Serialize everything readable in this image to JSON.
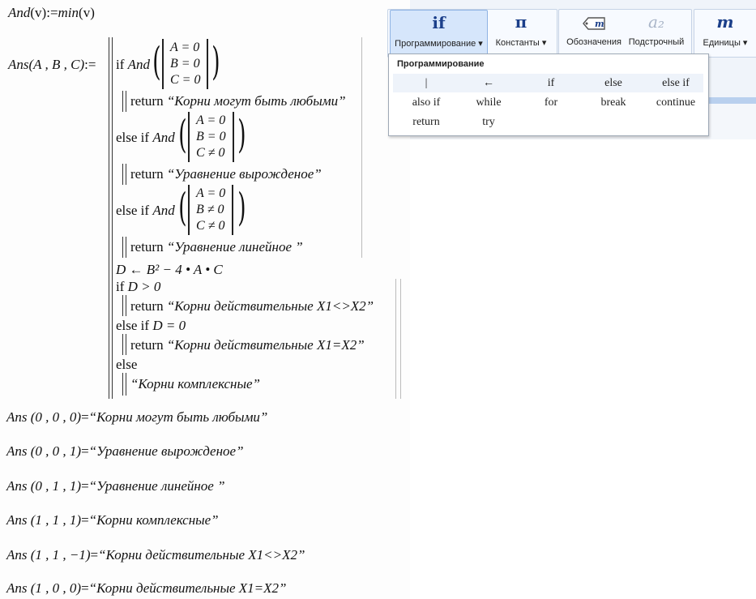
{
  "worksheet": {
    "def_and": {
      "lhs": "And",
      "arg": "(v)",
      "assign": ":=",
      "rhs": "min",
      "rhs_arg": "(v)"
    },
    "def_ans": {
      "lhs": "Ans",
      "args": "(A , B , C)",
      "assign": ":="
    },
    "conditions": [
      {
        "kw": "if",
        "fn": "And",
        "rows": [
          "A = 0",
          "B = 0",
          "C = 0"
        ],
        "ret_kw": "return",
        "ret": "“Корни могут быть любыми”"
      },
      {
        "kw": "else if",
        "fn": "And",
        "rows": [
          "A = 0",
          "B = 0",
          "C ≠ 0"
        ],
        "ret_kw": "return",
        "ret": "“Уравнение вырожденое”"
      },
      {
        "kw": "else if",
        "fn": "And",
        "rows": [
          "A = 0",
          "B ≠ 0",
          "C ≠ 0"
        ],
        "ret_kw": "return",
        "ret": "“Уравнение линейное ”"
      }
    ],
    "discriminant": "D ← B² − 4 • A • C",
    "branches": [
      {
        "kw": "if",
        "cond": "D > 0",
        "ret_kw": "return",
        "ret": "“Корни действительные X1<>X2”"
      },
      {
        "kw": "else if",
        "cond": "D = 0",
        "ret_kw": "return",
        "ret": "“Корни действительные X1=X2”"
      },
      {
        "kw": "else",
        "cond": "",
        "ret_kw": "",
        "ret": "“Корни комплексные”"
      }
    ],
    "results": [
      {
        "call": "Ans (0 , 0 , 0)",
        "eq": "=",
        "val": "“Корни могут быть любыми”"
      },
      {
        "call": "Ans (0 , 0 , 1)",
        "eq": "=",
        "val": "“Уравнение вырожденое”"
      },
      {
        "call": "Ans (0 , 1 , 1)",
        "eq": "=",
        "val": "“Уравнение линейное ”"
      },
      {
        "call": "Ans (1 , 1 , 1)",
        "eq": "=",
        "val": "“Корни комплексные”"
      },
      {
        "call": "Ans (1 , 1 , −1)",
        "eq": "=",
        "val": "“Корни действительные X1<>X2”"
      },
      {
        "call": "Ans (1 , 0 , 0)",
        "eq": "=",
        "val": "“Корни действительные X1=X2”"
      }
    ]
  },
  "ribbon": {
    "programming": {
      "icon": "if",
      "label": "Программирование ▾"
    },
    "constants": {
      "icon": "π",
      "label": "Константы ▾"
    },
    "notations": {
      "icon": "m",
      "label": "Обозначения"
    },
    "subscript": {
      "icon": "a₂",
      "label": "Подстрочный"
    },
    "units": {
      "icon": "m",
      "label": "Единицы ▾"
    }
  },
  "dropdown": {
    "title": "Программирование",
    "items": [
      "|",
      "←",
      "if",
      "else",
      "else if",
      "also if",
      "while",
      "for",
      "break",
      "continue",
      "return",
      "try"
    ]
  }
}
